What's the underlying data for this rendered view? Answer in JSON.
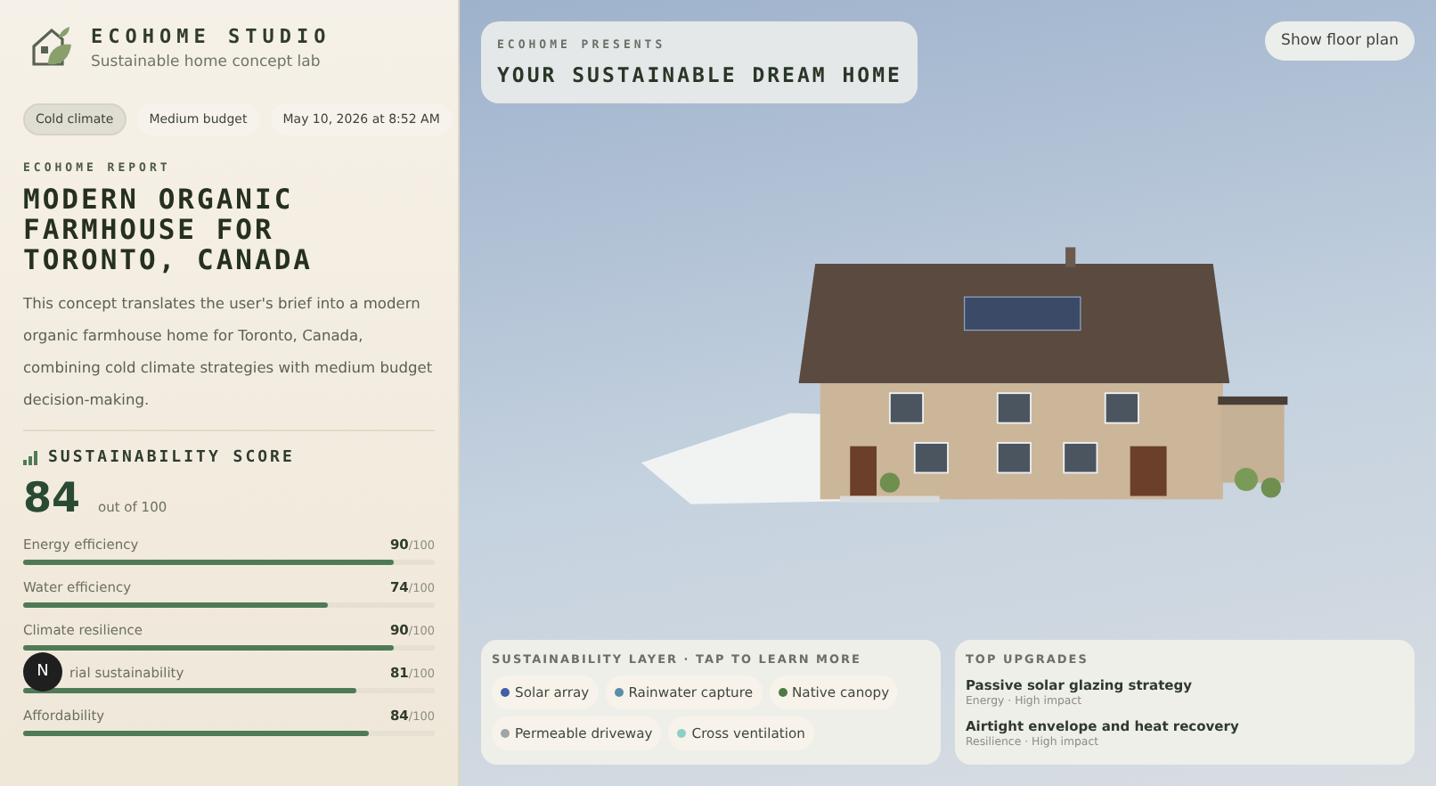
{
  "brand": {
    "name": "ECOHOME STUDIO",
    "tagline": "Sustainable home concept lab"
  },
  "chips": [
    {
      "label": "Cold climate",
      "selected": true
    },
    {
      "label": "Medium budget",
      "selected": false
    },
    {
      "label": "May 10, 2026 at 8:52 AM",
      "selected": false
    }
  ],
  "report": {
    "eyebrow": "ECOHOME REPORT",
    "title": "MODERN ORGANIC FARMHOUSE FOR TORONTO, CANADA",
    "summary": "This concept translates the user's brief into a modern organic farmhouse home for Toronto, Canada, combining cold climate strategies with medium budget decision-making."
  },
  "score": {
    "heading": "SUSTAINABILITY SCORE",
    "value": "84",
    "caption": "out of 100"
  },
  "metrics": [
    {
      "label": "Energy efficiency",
      "value": "90",
      "max": "/100",
      "level": 0.9
    },
    {
      "label": "Water efficiency",
      "value": "74",
      "max": "/100",
      "level": 0.74
    },
    {
      "label": "Climate resilience",
      "value": "90",
      "max": "/100",
      "level": 0.9
    },
    {
      "label": "rial sustainability",
      "value": "81",
      "max": "/100",
      "level": 0.81,
      "badge": "N"
    },
    {
      "label": "Affordability",
      "value": "84",
      "max": "/100",
      "level": 0.84
    }
  ],
  "scene": {
    "eyebrow": "ECOHOME PRESENTS",
    "title": "YOUR SUSTAINABLE DREAM HOME",
    "button": "Show floor plan"
  },
  "layer": {
    "heading": "SUSTAINABILITY LAYER · TAP TO LEARN MORE",
    "items": [
      {
        "label": "Solar array",
        "color": "#3f5fa8"
      },
      {
        "label": "Rainwater capture",
        "color": "#5b8fa8"
      },
      {
        "label": "Native canopy",
        "color": "#4f7a45"
      },
      {
        "label": "Permeable driveway",
        "color": "#a0a4a6"
      },
      {
        "label": "Cross ventilation",
        "color": "#8ccfc8"
      }
    ]
  },
  "upgrades": {
    "heading": "TOP UPGRADES",
    "items": [
      {
        "title": "Passive solar glazing strategy",
        "meta": "Energy · High impact"
      },
      {
        "title": "Airtight envelope and heat recovery",
        "meta": "Resilience · High impact"
      }
    ]
  }
}
